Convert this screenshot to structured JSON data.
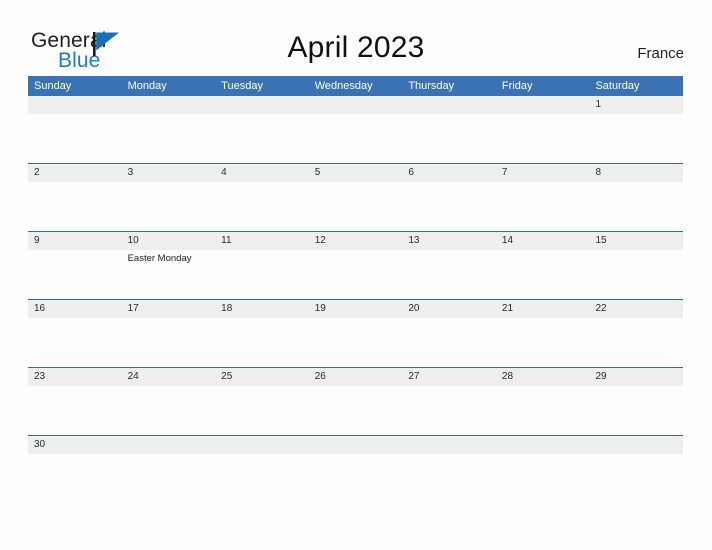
{
  "brand": {
    "name_part1": "General",
    "name_part2": "Blue",
    "flag_icon": "flag-triangle-icon",
    "color_dark": "#231f20",
    "color_blue": "#1a7cc4"
  },
  "header": {
    "title": "April 2023",
    "country": "France"
  },
  "theme": {
    "header_blue": "#3a72b4",
    "divider_blue": "#2e6ca4",
    "date_band_gray": "#eeeeee",
    "page_background": "#fefefe"
  },
  "calendar": {
    "weekdays": [
      "Sunday",
      "Monday",
      "Tuesday",
      "Wednesday",
      "Thursday",
      "Friday",
      "Saturday"
    ],
    "weeks": [
      {
        "days": [
          {
            "date": "",
            "events": []
          },
          {
            "date": "",
            "events": []
          },
          {
            "date": "",
            "events": []
          },
          {
            "date": "",
            "events": []
          },
          {
            "date": "",
            "events": []
          },
          {
            "date": "",
            "events": []
          },
          {
            "date": "1",
            "events": []
          }
        ]
      },
      {
        "days": [
          {
            "date": "2",
            "events": []
          },
          {
            "date": "3",
            "events": []
          },
          {
            "date": "4",
            "events": []
          },
          {
            "date": "5",
            "events": []
          },
          {
            "date": "6",
            "events": []
          },
          {
            "date": "7",
            "events": []
          },
          {
            "date": "8",
            "events": []
          }
        ]
      },
      {
        "days": [
          {
            "date": "9",
            "events": []
          },
          {
            "date": "10",
            "events": [
              "Easter Monday"
            ]
          },
          {
            "date": "11",
            "events": []
          },
          {
            "date": "12",
            "events": []
          },
          {
            "date": "13",
            "events": []
          },
          {
            "date": "14",
            "events": []
          },
          {
            "date": "15",
            "events": []
          }
        ]
      },
      {
        "days": [
          {
            "date": "16",
            "events": []
          },
          {
            "date": "17",
            "events": []
          },
          {
            "date": "18",
            "events": []
          },
          {
            "date": "19",
            "events": []
          },
          {
            "date": "20",
            "events": []
          },
          {
            "date": "21",
            "events": []
          },
          {
            "date": "22",
            "events": []
          }
        ]
      },
      {
        "days": [
          {
            "date": "23",
            "events": []
          },
          {
            "date": "24",
            "events": []
          },
          {
            "date": "25",
            "events": []
          },
          {
            "date": "26",
            "events": []
          },
          {
            "date": "27",
            "events": []
          },
          {
            "date": "28",
            "events": []
          },
          {
            "date": "29",
            "events": []
          }
        ]
      },
      {
        "days": [
          {
            "date": "30",
            "events": []
          },
          {
            "date": "",
            "events": []
          },
          {
            "date": "",
            "events": []
          },
          {
            "date": "",
            "events": []
          },
          {
            "date": "",
            "events": []
          },
          {
            "date": "",
            "events": []
          },
          {
            "date": "",
            "events": []
          }
        ]
      }
    ]
  }
}
